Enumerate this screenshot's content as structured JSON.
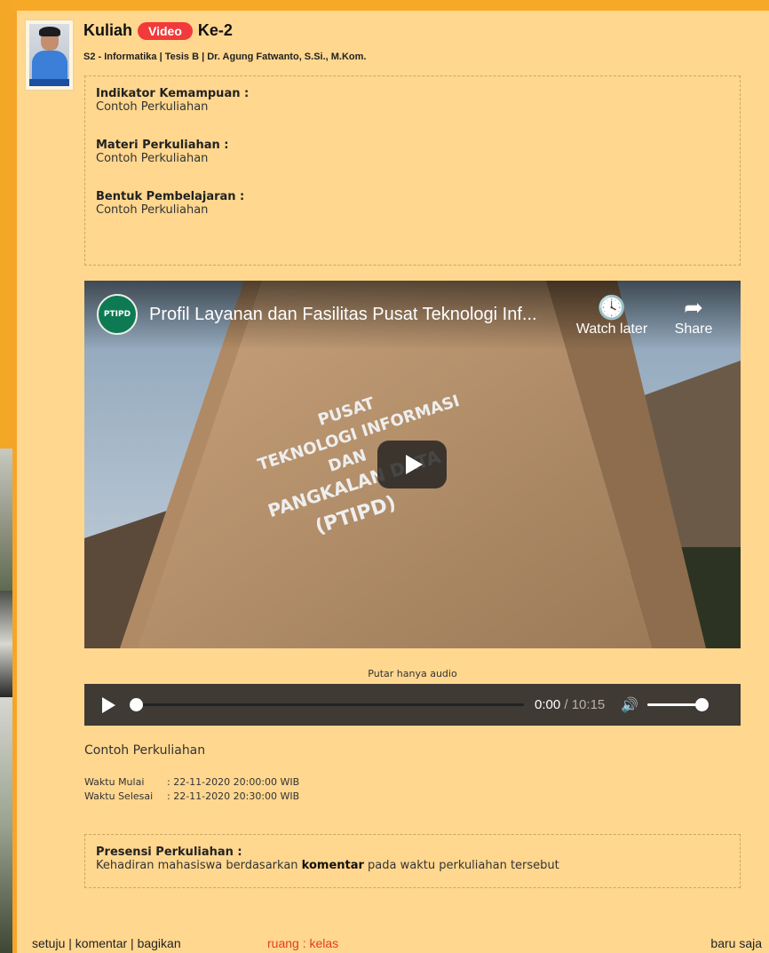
{
  "post": {
    "title_prefix": "Kuliah",
    "badge": "Video",
    "title_suffix": "Ke-2",
    "subtitle": "S2 - Informatika | Tesis B | Dr. Agung Fatwanto, S.Si., M.Kom."
  },
  "info": {
    "items": [
      {
        "label": "Indikator Kemampuan :",
        "value": "Contoh Perkuliahan"
      },
      {
        "label": "Materi Perkuliahan :",
        "value": "Contoh Perkuliahan"
      },
      {
        "label": "Bentuk Pembelajaran :",
        "value": "Contoh Perkuliahan"
      }
    ]
  },
  "video": {
    "channel_logo_text": "PTIPD",
    "title": "Profil Layanan dan Fasilitas Pusat Teknologi Inf...",
    "watch_later": "Watch later",
    "share": "Share",
    "sign_lines": [
      "PUSAT",
      "TEKNOLOGI INFORMASI",
      "DAN",
      "PANGKALAN DATA",
      "(PTIPD)"
    ],
    "icons": {
      "watch_later": "clock-icon",
      "share": "share-arrow-icon",
      "play": "play-icon"
    }
  },
  "audio": {
    "caption": "Putar hanya audio",
    "current_time": "0:00",
    "separator": " / ",
    "duration": "10:15",
    "progress": 0,
    "volume": 1
  },
  "description": "Contoh Perkuliahan",
  "schedule": {
    "start_label": "Waktu Mulai",
    "start_value": ": 22-11-2020 20:00:00 WIB",
    "end_label": "Waktu Selesai",
    "end_value": ": 22-11-2020 20:30:00 WIB"
  },
  "attendance": {
    "title": "Presensi Perkuliahan :",
    "text_before": "Kehadiran mahasiswa berdasarkan ",
    "text_bold": "komentar",
    "text_after": " pada waktu perkuliahan tersebut"
  },
  "footer": {
    "agree": "setuju",
    "comment": "komentar",
    "share": "bagikan",
    "separator": " | ",
    "room": "ruang : kelas",
    "posted": "baru saja"
  },
  "colors": {
    "page_bg": "#f7a827",
    "card_bg": "#ffd78f",
    "badge": "#f23a3a",
    "room_link": "#e53c1c",
    "audio_bar": "#3f3a33"
  }
}
